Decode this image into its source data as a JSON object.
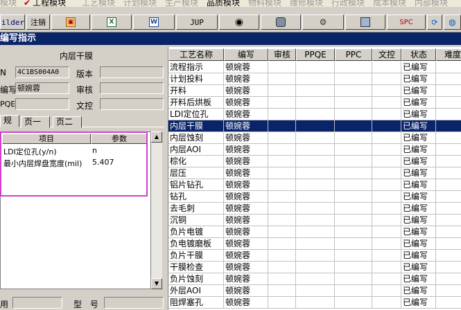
{
  "menu": {
    "modules": [
      "模块",
      "工程模块",
      "工艺模块",
      "计划模块",
      "生产模块",
      "品质模块",
      "物料模块",
      "维修模块",
      "行政模块",
      "成本模块",
      "内部模块"
    ]
  },
  "toolbar": {
    "builder_label": "ilder",
    "logout_label": "注销",
    "jup_label": "JUP",
    "spc_label": "SPC"
  },
  "window": {
    "title": "编写指示"
  },
  "form": {
    "section_title": "内层干膜",
    "n_label": "N",
    "n_value": "4C1BS004A0",
    "version_label": "版本",
    "version_value": "",
    "writer_label": "编写",
    "writer_value": "顿婉蓉",
    "reviewer_label": "审核",
    "reviewer_value": "",
    "ppqe_label": "PQE",
    "ppqe_value": "",
    "doc_control_label": "文控",
    "doc_control_value": "",
    "bottom_label_left": "用",
    "bottom_value_left": "",
    "model_label": "型 号",
    "model_value": ""
  },
  "tabs": [
    "规",
    "页一",
    "页二"
  ],
  "params": {
    "headers": [
      "项目",
      "参数"
    ],
    "rows": [
      {
        "item": "LDI定位孔(y/n)",
        "value": "n"
      },
      {
        "item": "最小内层焊盘宽度(mil)",
        "value": "5.407"
      }
    ]
  },
  "process_table": {
    "headers": [
      "工艺名称",
      "编写",
      "审核",
      "PPQE",
      "PPC",
      "文控",
      "状态",
      "难度系"
    ],
    "selected_index": 5,
    "rows": [
      {
        "name": "流程指示",
        "writer": "顿婉蓉",
        "status": "已编写"
      },
      {
        "name": "计划投料",
        "writer": "顿婉蓉",
        "status": "已编写"
      },
      {
        "name": "开料",
        "writer": "顿婉蓉",
        "status": "已编写"
      },
      {
        "name": "开料后烘板",
        "writer": "顿婉蓉",
        "status": "已编写"
      },
      {
        "name": "LDI定位孔",
        "writer": "顿婉蓉",
        "status": "已编写"
      },
      {
        "name": "内层干膜",
        "writer": "顿婉蓉",
        "status": "已编写"
      },
      {
        "name": "内层蚀刻",
        "writer": "顿婉蓉",
        "status": "已编写"
      },
      {
        "name": "内层AOI",
        "writer": "顿婉蓉",
        "status": "已编写"
      },
      {
        "name": "棕化",
        "writer": "顿婉蓉",
        "status": "已编写"
      },
      {
        "name": "层压",
        "writer": "顿婉蓉",
        "status": "已编写"
      },
      {
        "name": "铝片钻孔",
        "writer": "顿婉蓉",
        "status": "已编写"
      },
      {
        "name": "钻孔",
        "writer": "顿婉蓉",
        "status": "已编写"
      },
      {
        "name": "去毛刺",
        "writer": "顿婉蓉",
        "status": "已编写"
      },
      {
        "name": "沉铜",
        "writer": "顿婉蓉",
        "status": "已编写"
      },
      {
        "name": "负片电镀",
        "writer": "顿婉蓉",
        "status": "已编写"
      },
      {
        "name": "负电镀磨板",
        "writer": "顿婉蓉",
        "status": "已编写"
      },
      {
        "name": "负片干膜",
        "writer": "顿婉蓉",
        "status": "已编写"
      },
      {
        "name": "干膜检查",
        "writer": "顿婉蓉",
        "status": "已编写"
      },
      {
        "name": "负片蚀刻",
        "writer": "顿婉蓉",
        "status": "已编写"
      },
      {
        "name": "外层AOI",
        "writer": "顿婉蓉",
        "status": "已编写"
      },
      {
        "name": "阻焊塞孔",
        "writer": "顿婉蓉",
        "status": "已编写"
      }
    ]
  },
  "colors": {
    "selection": "#0a246a",
    "highlight_box": "#d040d0",
    "active_check": "#c00000"
  }
}
